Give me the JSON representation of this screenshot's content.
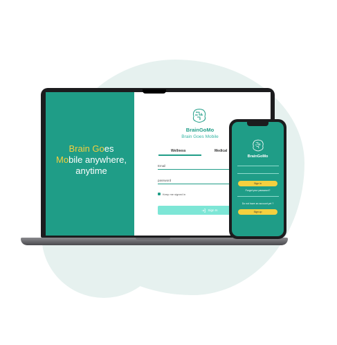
{
  "laptop": {
    "tagline_line1_highlight": "Brain Go",
    "tagline_line1_rest": "es",
    "tagline_line2_highlight": "Mo",
    "tagline_line2_rest": "bile anywhere,",
    "tagline_line3": "anytime",
    "brand_name": "BrainGoMo",
    "brand_subtitle": "Brain Goes Mobile",
    "tabs": [
      "Wellness",
      "Medical"
    ],
    "email_placeholder": "Email",
    "password_placeholder": "password",
    "keep_signed_in_label": "Keep me signed in",
    "sign_in_label": "Sign In",
    "login_icon": "login-arrow-icon"
  },
  "phone": {
    "brand_name": "BrainGoMo",
    "sign_in_label": "Sign in",
    "forgot_password_label": "Forgot your password?",
    "no_account_label": "Do not have an account yet ?",
    "sign_up_label": "Sign up"
  },
  "colors": {
    "teal": "#1f9d87",
    "light_teal": "#7de6d6",
    "yellow": "#f4d03f",
    "blob": "#e6f1ef"
  }
}
